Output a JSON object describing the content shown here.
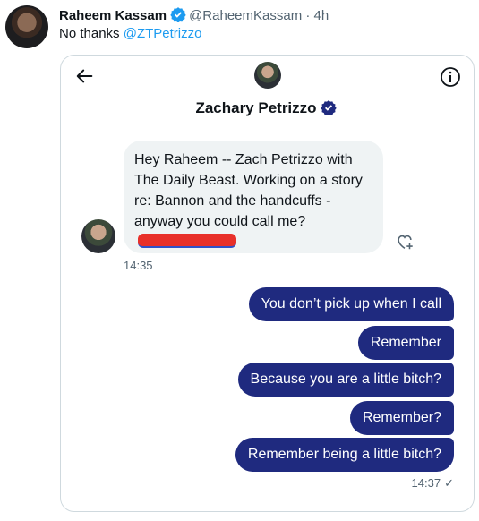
{
  "tweet": {
    "author_name": "Raheem Kassam",
    "handle": "@RaheemKassam",
    "separator": "·",
    "time": "4h",
    "text_prefix": "No thanks ",
    "mention": "@ZTPetrizzo"
  },
  "dm": {
    "contact_name": "Zachary Petrizzo",
    "incoming": {
      "text": "Hey Raheem -- Zach Petrizzo with The Daily Beast. Working on a story re: Bannon and the handcuffs - anyway you could call me?",
      "time": "14:35"
    },
    "outgoing": [
      {
        "text": "You don’t pick up when I call"
      },
      {
        "text": "Remember"
      },
      {
        "text": "Because you are a little bitch?"
      },
      {
        "text": "Remember?"
      },
      {
        "text": "Remember being a little bitch?"
      }
    ],
    "outgoing_time": "14:37",
    "read_mark": "✓"
  },
  "colors": {
    "verified": "#1d9bf0",
    "outgoing_bubble": "#1f2a7f",
    "incoming_bubble": "#eff3f4",
    "link": "#1d9bf0",
    "redaction": "#e8302a"
  },
  "icons": [
    "verified-badge-icon",
    "back-arrow-icon",
    "info-icon",
    "heart-add-icon",
    "checkmark-icon"
  ]
}
